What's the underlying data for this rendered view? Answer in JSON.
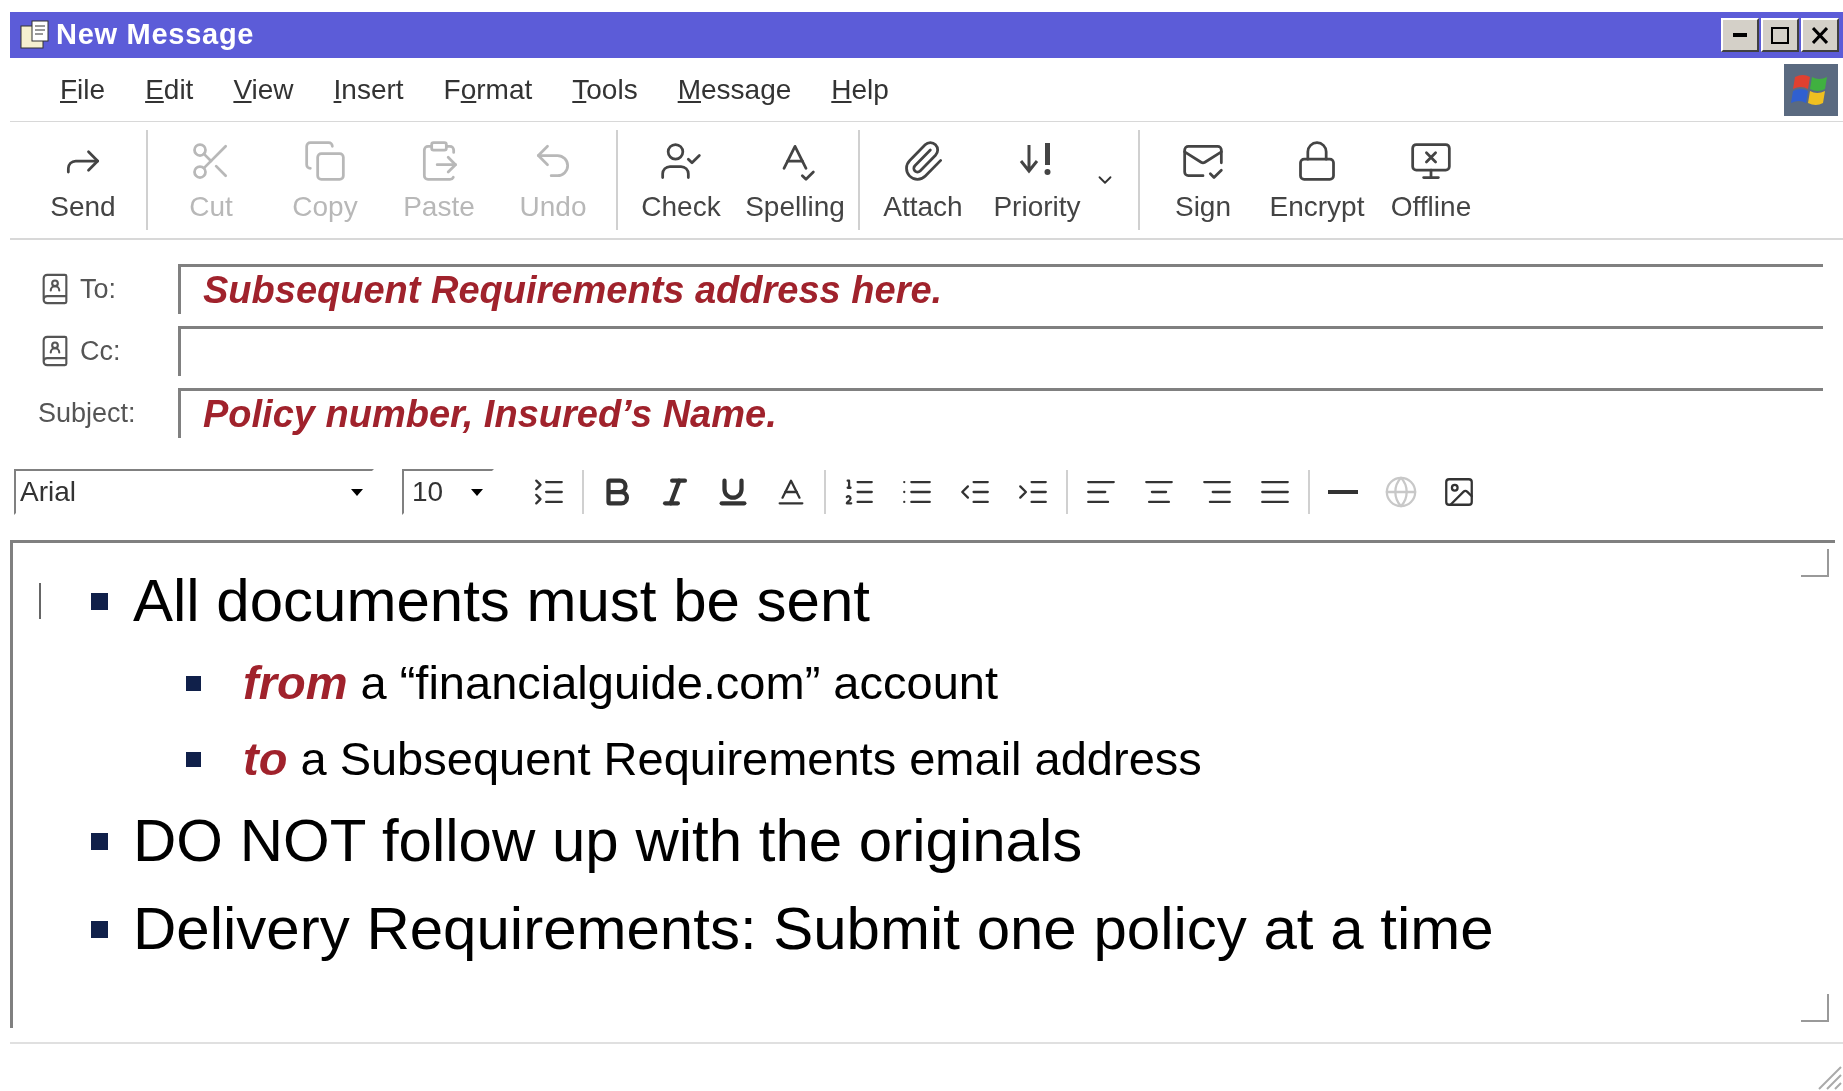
{
  "window": {
    "title": "New Message"
  },
  "menu": [
    {
      "key": "F",
      "post": "ile"
    },
    {
      "key": "E",
      "post": "dit"
    },
    {
      "key": "V",
      "post": "iew"
    },
    {
      "key": "I",
      "post": "nsert"
    },
    {
      "pre": "F",
      "key": "o",
      "post": "rmat"
    },
    {
      "key": "T",
      "post": "ools"
    },
    {
      "key": "M",
      "post": "essage"
    },
    {
      "key": "H",
      "post": "elp"
    }
  ],
  "toolbar": [
    {
      "label": "Send",
      "disabled": false
    },
    {
      "label": "Cut",
      "disabled": true
    },
    {
      "label": "Copy",
      "disabled": true
    },
    {
      "label": "Paste",
      "disabled": true
    },
    {
      "label": "Undo",
      "disabled": true
    },
    {
      "label": "Check",
      "disabled": false
    },
    {
      "label": "Spelling",
      "disabled": false
    },
    {
      "label": "Attach",
      "disabled": false
    },
    {
      "label": "Priority",
      "disabled": false
    },
    {
      "label": "Sign",
      "disabled": false
    },
    {
      "label": "Encrypt",
      "disabled": false
    },
    {
      "label": "Offline",
      "disabled": false
    }
  ],
  "fields": [
    {
      "label": "To:",
      "value": "Subsequent Requirements address here."
    },
    {
      "label": "Cc:"
    },
    {
      "label": "Subject:",
      "value": "Policy number, Insured’s Name."
    }
  ],
  "format_bar": {
    "font": "Arial",
    "size": "10",
    "buttons": [
      {
        "disabled": false
      },
      {
        "disabled": false
      },
      {
        "disabled": false
      },
      {
        "disabled": false
      },
      {
        "disabled": false
      },
      {
        "disabled": false
      },
      {
        "disabled": false
      },
      {
        "disabled": false
      },
      {
        "disabled": false
      },
      {
        "disabled": false
      },
      {
        "disabled": false
      },
      {
        "disabled": false
      },
      {
        "disabled": false
      },
      {
        "disabled": false
      },
      {
        "disabled": true
      },
      {
        "disabled": false
      }
    ]
  },
  "body": [
    {
      "text": "All documents must be sent",
      "children": [
        {
          "emphasis": "from",
          "text": "a “financialguide.com” account"
        },
        {
          "emphasis": "to",
          "text": "a Subsequent Requirements email address"
        }
      ]
    },
    {
      "text": "DO NOT follow up with the originals"
    },
    {
      "text": "Delivery Requirements: Submit one policy at a time"
    }
  ]
}
